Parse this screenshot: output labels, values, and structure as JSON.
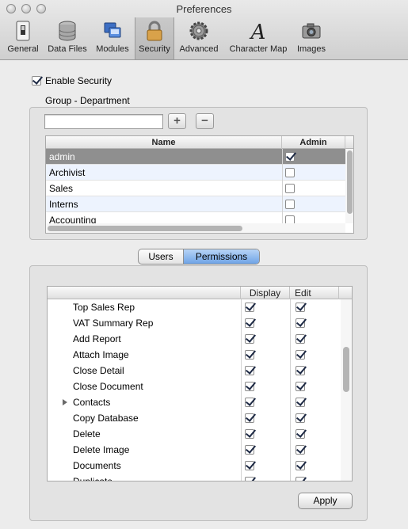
{
  "window": {
    "title": "Preferences"
  },
  "toolbar": {
    "items": [
      {
        "label": "General",
        "icon": "switch-icon"
      },
      {
        "label": "Data Files",
        "icon": "database-icon"
      },
      {
        "label": "Modules",
        "icon": "modules-icon"
      },
      {
        "label": "Security",
        "icon": "padlock-icon",
        "selected": true
      },
      {
        "label": "Advanced",
        "icon": "gear-icon"
      },
      {
        "label": "Character Map",
        "icon": "letter-a-icon"
      },
      {
        "label": "Images",
        "icon": "camera-icon"
      }
    ]
  },
  "security": {
    "enable_label": "Enable Security",
    "enable_checked": true,
    "group_label": "Group - Department",
    "search_value": "",
    "add_label": "+",
    "remove_label": "−"
  },
  "groups_table": {
    "columns": [
      "Name",
      "Admin"
    ],
    "rows": [
      {
        "name": "admin",
        "admin": true,
        "selected": true
      },
      {
        "name": "Archivist",
        "admin": false
      },
      {
        "name": "Sales",
        "admin": false
      },
      {
        "name": "Interns",
        "admin": false
      },
      {
        "name": "Accounting",
        "admin": false
      }
    ]
  },
  "tabs": {
    "items": [
      "Users",
      "Permissions"
    ],
    "active": "Permissions"
  },
  "permissions_table": {
    "columns": [
      "Display",
      "Edit"
    ],
    "rows": [
      {
        "name": "Top Sales Rep",
        "display": true,
        "edit": true
      },
      {
        "name": "VAT Summary Rep",
        "display": true,
        "edit": true
      },
      {
        "name": "Add Report",
        "display": true,
        "edit": true
      },
      {
        "name": "Attach Image",
        "display": true,
        "edit": true
      },
      {
        "name": "Close Detail",
        "display": true,
        "edit": true
      },
      {
        "name": "Close Document",
        "display": true,
        "edit": true
      },
      {
        "name": "Contacts",
        "display": true,
        "edit": true,
        "expandable": true
      },
      {
        "name": "Copy Database",
        "display": true,
        "edit": true
      },
      {
        "name": "Delete",
        "display": true,
        "edit": true
      },
      {
        "name": "Delete Image",
        "display": true,
        "edit": true
      },
      {
        "name": "Documents",
        "display": true,
        "edit": true
      },
      {
        "name": "Duplicate",
        "display": true,
        "edit": true
      }
    ]
  },
  "apply_label": "Apply",
  "colors": {
    "selection": "#8f8f8f",
    "row_alt": "#edf3fe",
    "accent": "#6fa3e6"
  }
}
